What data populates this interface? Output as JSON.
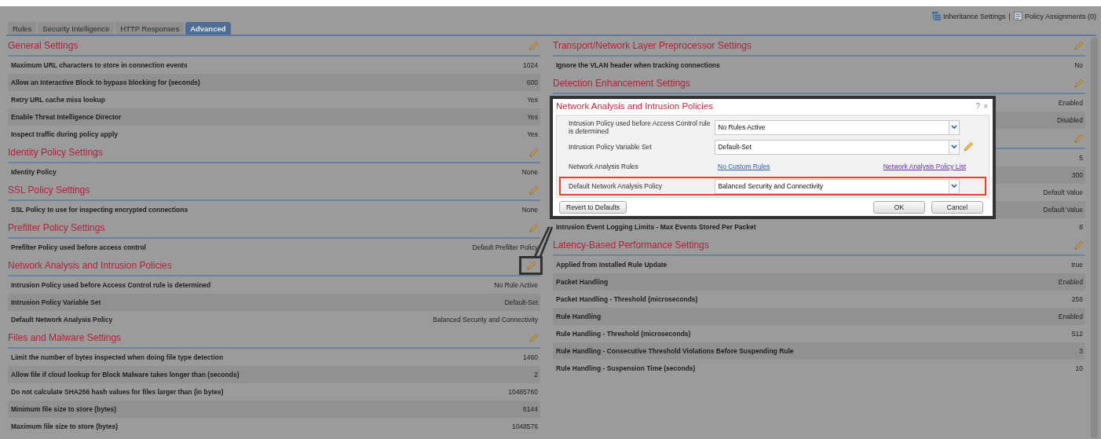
{
  "header_links": [
    {
      "label": "Inheritance Settings"
    },
    {
      "label": "Policy Assignments (0)"
    }
  ],
  "header_separator": "|",
  "tabs": [
    {
      "label": "Rules",
      "selected": false
    },
    {
      "label": "Security Intelligence",
      "selected": false
    },
    {
      "label": "HTTP Responses",
      "selected": false
    },
    {
      "label": "Advanced",
      "selected": true
    }
  ],
  "left_sections": [
    {
      "title": "General Settings",
      "callout": false,
      "rows": [
        {
          "label": "Maximum URL characters to store in connection events",
          "value": "1024"
        },
        {
          "label": "Allow an Interactive Block to bypass blocking for (seconds)",
          "value": "600"
        },
        {
          "label": "Retry URL cache miss lookup",
          "value": "Yes"
        },
        {
          "label": "Enable Threat Intelligence Director",
          "value": "Yes"
        },
        {
          "label": "Inspect traffic during policy apply",
          "value": "Yes"
        }
      ]
    },
    {
      "title": "Identity Policy Settings",
      "callout": false,
      "rows": [
        {
          "label": "Identity Policy",
          "value": "None"
        }
      ]
    },
    {
      "title": "SSL Policy Settings",
      "callout": false,
      "rows": [
        {
          "label": "SSL Policy to use for inspecting encrypted connections",
          "value": "None"
        }
      ]
    },
    {
      "title": "Prefilter Policy Settings",
      "callout": false,
      "rows": [
        {
          "label": "Prefilter Policy used before access control",
          "value": "Default Prefilter Policy"
        }
      ]
    },
    {
      "title": "Network Analysis and Intrusion Policies",
      "callout": true,
      "rows": [
        {
          "label": "Intrusion Policy used before Access Control rule is determined",
          "value": "No Rule Active"
        },
        {
          "label": "Intrusion Policy Variable Set",
          "value": "Default-Set"
        },
        {
          "label": "Default Network Analysis Policy",
          "value": "Balanced Security and Connectivity"
        }
      ]
    },
    {
      "title": "Files and Malware Settings",
      "callout": false,
      "rows": [
        {
          "label": "Limit the number of bytes inspected when doing file type detection",
          "value": "1460"
        },
        {
          "label": "Allow file if cloud lookup for Block Malware takes longer than (seconds)",
          "value": "2"
        },
        {
          "label": "Do not calculate SHA256 hash values for files larger than (in bytes)",
          "value": "10485760"
        },
        {
          "label": "Minimum file size to store (bytes)",
          "value": "6144"
        },
        {
          "label": "Maximum file size to store (bytes)",
          "value": "1048576"
        }
      ]
    }
  ],
  "right_sections": [
    {
      "title": "Transport/Network Layer Preprocessor Settings",
      "callout": false,
      "rows": [
        {
          "label": "Ignore the VLAN header when tracking connections",
          "value": "No"
        }
      ]
    },
    {
      "title": "Detection Enhancement Settings",
      "callout": false,
      "rows": [
        {
          "value": "Enabled"
        },
        {
          "value": "Disabled"
        }
      ]
    },
    {
      "callout": false,
      "rows": [
        {
          "value": "5"
        },
        {
          "value": "300"
        },
        {
          "value": "Default Value"
        },
        {
          "value": "Default Value"
        },
        {
          "label": "Intrusion Event Logging Limits - Max Events Stored Per Packet",
          "value": "8"
        }
      ]
    },
    {
      "title": "Latency-Based Performance Settings",
      "callout": false,
      "rows": [
        {
          "label": "Applied from Installed Rule Update",
          "value": "true"
        },
        {
          "label": "Packet Handling",
          "value": "Enabled"
        },
        {
          "label": "Packet Handling - Threshold (microseconds)",
          "value": "256"
        },
        {
          "label": "Rule Handling",
          "value": "Enabled"
        },
        {
          "label": "Rule Handling - Threshold (microseconds)",
          "value": "512"
        },
        {
          "label": "Rule Handling - Consecutive Threshold Violations Before Suspending Rule",
          "value": "3"
        },
        {
          "label": "Rule Handling - Suspension Time (seconds)",
          "value": "10"
        }
      ]
    }
  ],
  "dialog": {
    "title": "Network Analysis and Intrusion Policies",
    "help": "?",
    "close": "×",
    "rows": [
      {
        "kind": "select",
        "label": "Intrusion Policy used before Access Control rule is determined",
        "value": "No Rules Active",
        "editable": false,
        "highlighted": false
      },
      {
        "kind": "select",
        "label": "Intrusion Policy Variable Set",
        "value": "Default-Set",
        "editable": true,
        "highlighted": false
      },
      {
        "kind": "links",
        "label": "Network Analysis Rules",
        "links": [
          {
            "label": "No Custom Rules",
            "visited": false
          },
          {
            "label": "Network Analysis Policy List",
            "visited": true
          }
        ]
      },
      {
        "kind": "select",
        "label": "Default Network Analysis Policy",
        "value": "Balanced Security and Connectivity",
        "editable": false,
        "highlighted": true
      }
    ],
    "reset_button": "Revert to Defaults",
    "buttons": [
      "OK",
      "Cancel"
    ]
  }
}
